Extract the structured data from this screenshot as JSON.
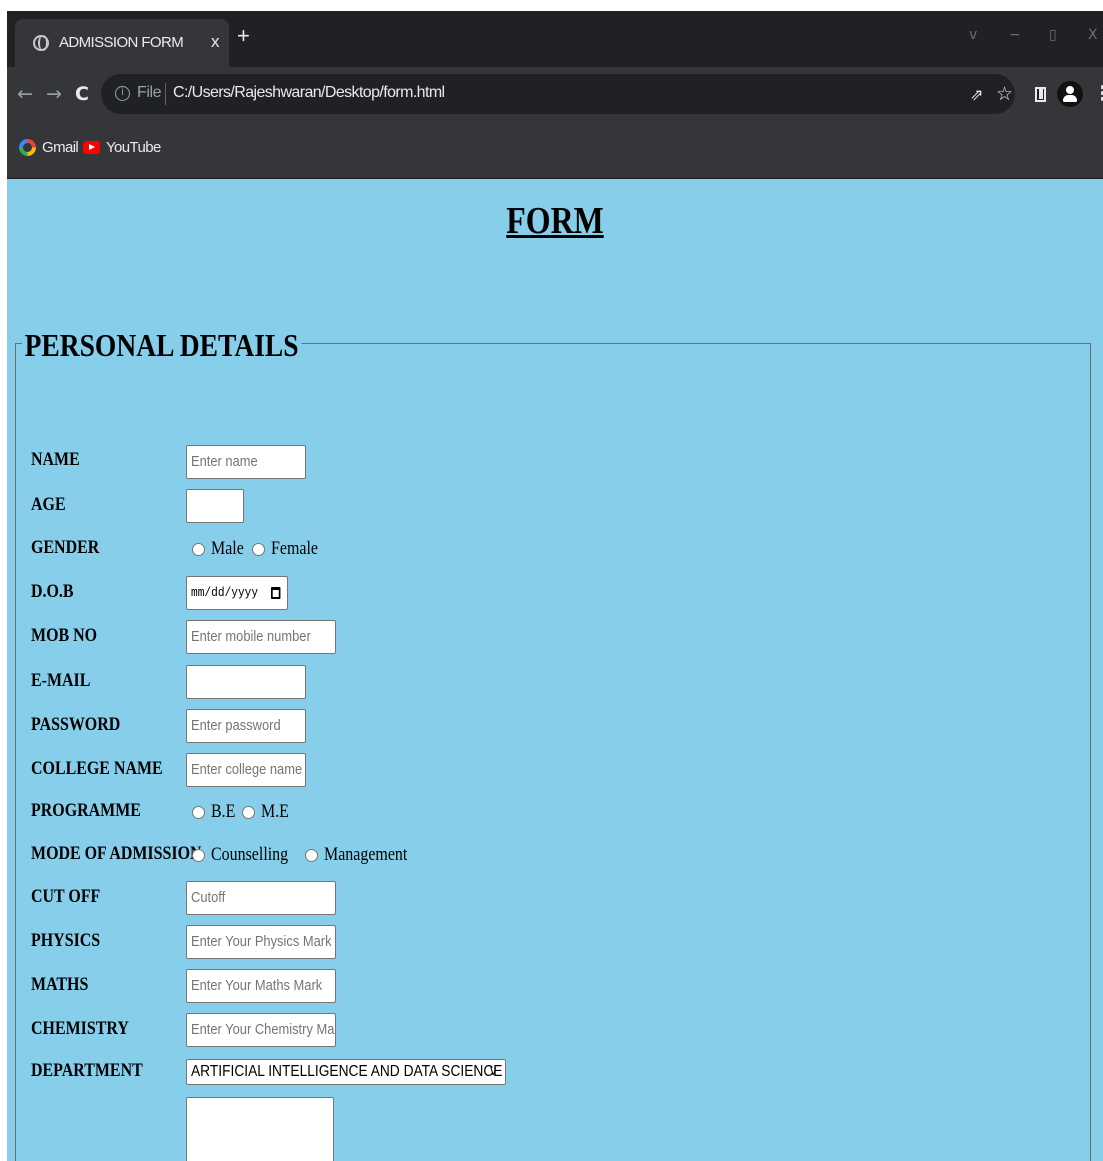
{
  "browser": {
    "tab_title": "ADMISSION FORM",
    "tab_close": "x",
    "new_tab": "+",
    "window_controls": {
      "minimize_chevron": "v",
      "minimize": "−",
      "restore": "▯",
      "close": "X"
    },
    "nav": {
      "back": "←",
      "forward": "→",
      "reload": "C"
    },
    "address": {
      "file_label": "File",
      "url": "C:/Users/Rajeshwaran/Desktop/form.html"
    },
    "toolbar_icons": {
      "share": "share-icon",
      "star": "star-icon",
      "side_panel": "side-panel-icon",
      "profile": "profile-icon",
      "menu": "menu-icon"
    },
    "bookmarks": [
      {
        "label": "Gmail",
        "icon": "gmail-icon"
      },
      {
        "label": "YouTube",
        "icon": "youtube-icon"
      }
    ],
    "colors": {
      "frame": "#202124",
      "toolbar": "#35363a",
      "page_bg": "#87ceeb"
    }
  },
  "form": {
    "title": "FORM",
    "legend": "PERSONAL DETAILS",
    "name": {
      "label": "NAME",
      "placeholder": "Enter name"
    },
    "age": {
      "label": "AGE",
      "value": ""
    },
    "gender": {
      "label": "GENDER",
      "options": [
        "Male",
        "Female"
      ]
    },
    "dob": {
      "label": "D.O.B",
      "placeholder": "mm/dd/yyyy"
    },
    "mobile": {
      "label": "MOB NO",
      "placeholder": "Enter mobile number"
    },
    "email": {
      "label": "E-MAIL",
      "value": ""
    },
    "password": {
      "label": "PASSWORD",
      "placeholder": "Enter password"
    },
    "college": {
      "label": "COLLEGE NAME",
      "placeholder": "Enter college name"
    },
    "programme": {
      "label": "PROGRAMME",
      "options": [
        "B.E",
        "M.E"
      ]
    },
    "admission_mode": {
      "label": "MODE OF ADMISSION",
      "options": [
        "Counselling",
        "Management"
      ]
    },
    "cutoff": {
      "label": "CUT OFF",
      "placeholder": "Cutoff"
    },
    "physics": {
      "label": "PHYSICS",
      "placeholder": "Enter Your Physics Mark"
    },
    "maths": {
      "label": "MATHS",
      "placeholder": "Enter Your Maths Mark"
    },
    "chemistry": {
      "label": "CHEMISTRY",
      "placeholder": "Enter Your Chemistry Ma"
    },
    "department": {
      "label": "DEPARTMENT",
      "selected": "ARTIFICIAL INTELLIGENCE AND DATA SCIENCE",
      "chevron": "v"
    }
  }
}
